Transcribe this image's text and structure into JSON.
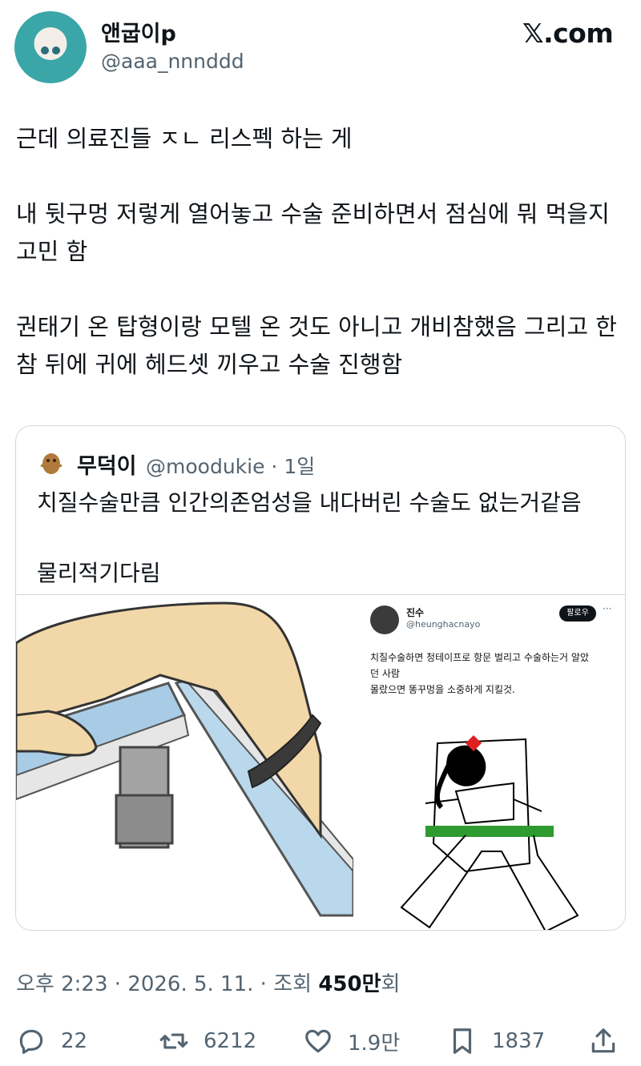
{
  "brand": {
    "logo_text": "𝕏.com"
  },
  "author": {
    "name": "앤굽이p",
    "handle": "@aaa_nnnddd"
  },
  "tweet": {
    "paragraphs": [
      "근데 의료진들 ㅈㄴ 리스펙 하는 게",
      "내 뒷구멍 저렇게 열어놓고 수술 준비하면서 점심에 뭐 먹을지 고민 함",
      "권태기 온 탑형이랑 모텔 온 것도 아니고 개비참했음 그리고 한참 뒤에 귀에 헤드셋 끼우고 수술 진행함"
    ]
  },
  "quote": {
    "name": "무덕이",
    "handle": "@moodukie",
    "time": "1일",
    "line1": "치질수술만큼 인간의존엄성을 내다버린 수술도 없는거같음",
    "line2": "물리적기다림",
    "embedded": {
      "name": "진수",
      "handle": "@heunghacnayo",
      "follow_label": "팔로우",
      "more": "···",
      "text1": "치질수술하면 청테이프로 항문 벌리고 수술하는거 알았",
      "text2": "던 사람",
      "text3": "몰랐으면 똥꾸멍을 소중하게 지킬것."
    }
  },
  "timestamp": {
    "prefix": "오후 2:23 · 2026. 5. 11. · 조회 ",
    "views": "450만",
    "suffix": "회"
  },
  "actions": {
    "replies": "22",
    "retweets": "6212",
    "likes": "1.9만",
    "bookmarks": "1837"
  },
  "icons": [
    "reply-icon",
    "retweet-icon",
    "like-icon",
    "bookmark-icon",
    "share-icon"
  ],
  "colors": {
    "text": "#0f1419",
    "secondary": "#536471",
    "border": "#cfd9de",
    "tape": "#2f9a2f"
  }
}
